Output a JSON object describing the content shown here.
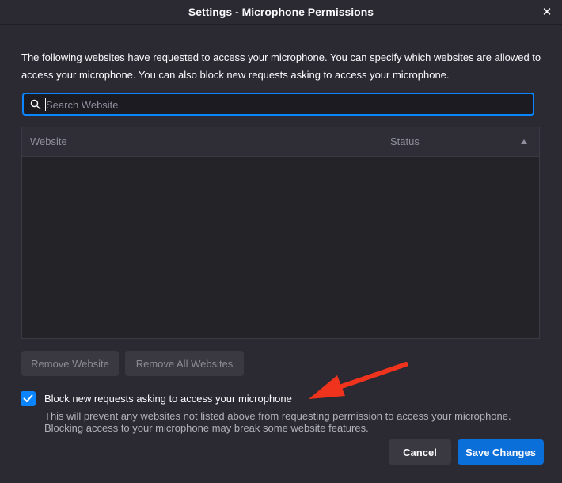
{
  "window": {
    "title": "Settings - Microphone Permissions",
    "close_icon": "close-icon"
  },
  "intro_text": "The following websites have requested to access your microphone. You can specify which websites are allowed to access your microphone. You can also block new requests asking to access your microphone.",
  "search": {
    "placeholder": "Search Website",
    "value": ""
  },
  "table": {
    "columns": [
      "Website",
      "Status"
    ],
    "sort_indicator": "ascending",
    "rows": []
  },
  "buttons": {
    "remove_website": "Remove Website",
    "remove_all_websites": "Remove All Websites",
    "cancel": "Cancel",
    "save_changes": "Save Changes"
  },
  "block_requests": {
    "checked": true,
    "label": "Block new requests asking to access your microphone",
    "description": "This will prevent any websites not listed above from requesting permission to access your microphone. Blocking access to your microphone may break some website features."
  },
  "colors": {
    "accent": "#0a84ff",
    "primary_button": "#0a6fd8",
    "annotation_arrow": "#f0331c"
  }
}
